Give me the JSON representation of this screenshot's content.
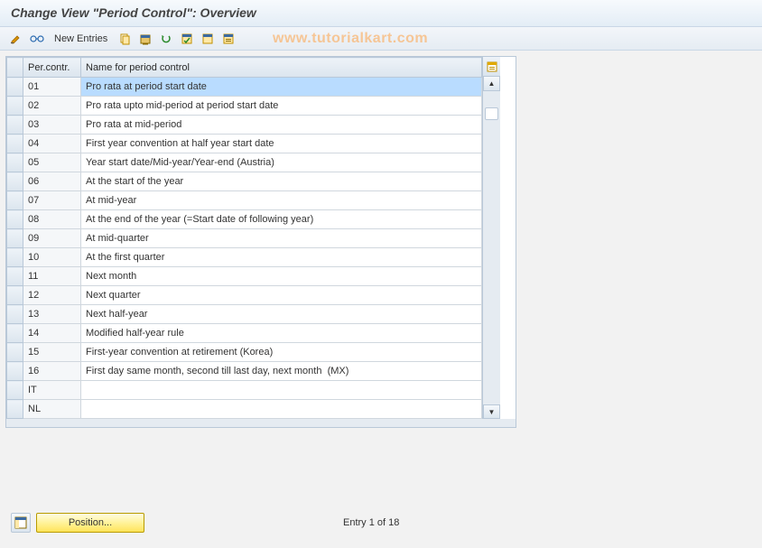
{
  "title": "Change View \"Period Control\": Overview",
  "toolbar": {
    "new_entries": "New Entries"
  },
  "watermark": "www.tutorialkart.com",
  "columns": {
    "code": "Per.contr.",
    "name": "Name for period control"
  },
  "rows": [
    {
      "code": "01",
      "name": "Pro rata at period start date",
      "selected": true
    },
    {
      "code": "02",
      "name": "Pro rata upto mid-period at period start date"
    },
    {
      "code": "03",
      "name": "Pro rata at mid-period"
    },
    {
      "code": "04",
      "name": "First year convention at half year start date"
    },
    {
      "code": "05",
      "name": "Year start date/Mid-year/Year-end (Austria)"
    },
    {
      "code": "06",
      "name": "At the start of the year"
    },
    {
      "code": "07",
      "name": "At mid-year"
    },
    {
      "code": "08",
      "name": "At the end of the year (=Start date of following year)"
    },
    {
      "code": "09",
      "name": "At mid-quarter"
    },
    {
      "code": "10",
      "name": "At the first quarter"
    },
    {
      "code": "11",
      "name": "Next month"
    },
    {
      "code": "12",
      "name": "Next quarter"
    },
    {
      "code": "13",
      "name": "Next half-year"
    },
    {
      "code": "14",
      "name": "Modified half-year rule"
    },
    {
      "code": "15",
      "name": "First-year convention at retirement (Korea)"
    },
    {
      "code": "16",
      "name": "First day same month, second till last day, next month  (MX)"
    },
    {
      "code": "IT",
      "name": ""
    },
    {
      "code": "NL",
      "name": ""
    }
  ],
  "footer": {
    "position_btn": "Position...",
    "status": "Entry 1 of 18"
  }
}
